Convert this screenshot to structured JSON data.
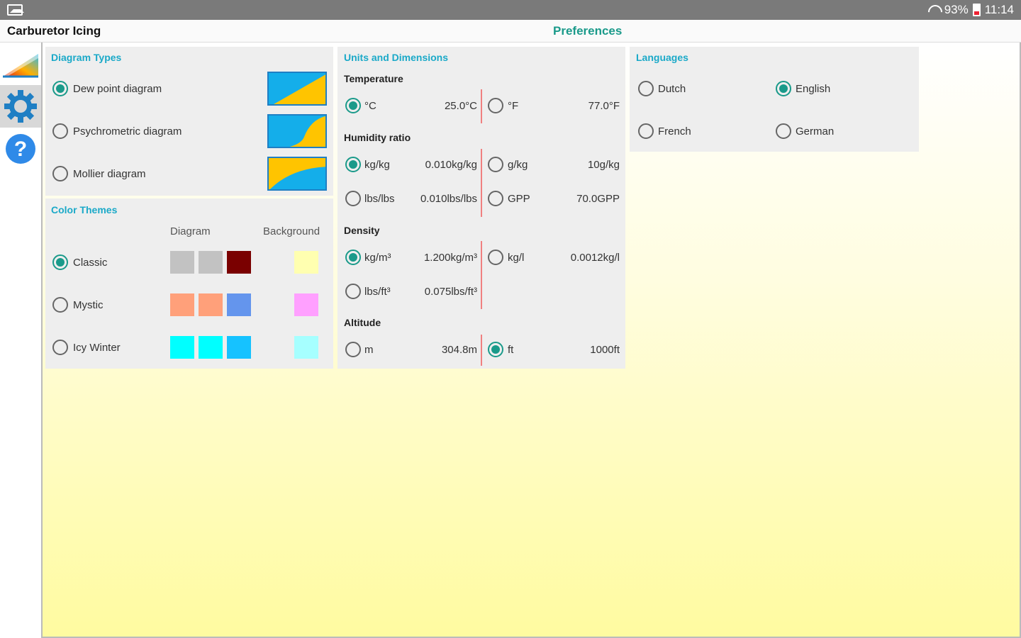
{
  "status": {
    "battery": "93%",
    "time": "11:14"
  },
  "app": {
    "title": "Carburetor Icing",
    "page_title": "Preferences"
  },
  "sidebar": [
    {
      "name": "diagram",
      "active": false
    },
    {
      "name": "settings",
      "active": true
    },
    {
      "name": "help",
      "active": false
    }
  ],
  "diagram_types": {
    "title": "Diagram Types",
    "options": [
      {
        "label": "Dew point diagram",
        "selected": true
      },
      {
        "label": "Psychrometric diagram",
        "selected": false
      },
      {
        "label": "Mollier diagram",
        "selected": false
      }
    ]
  },
  "color_themes": {
    "title": "Color Themes",
    "col_diagram": "Diagram",
    "col_background": "Background",
    "themes": [
      {
        "label": "Classic",
        "selected": true,
        "colors": [
          "#c2c2c2",
          "#c2c2c2",
          "#7a0000"
        ],
        "background": "#ffffb0"
      },
      {
        "label": "Mystic",
        "selected": false,
        "colors": [
          "#ffa07a",
          "#ffa07a",
          "#6495ed"
        ],
        "background": "#ffa0ff"
      },
      {
        "label": "Icy Winter",
        "selected": false,
        "colors": [
          "#00ffff",
          "#00ffff",
          "#16c2ff"
        ],
        "background": "#a6ffff"
      }
    ]
  },
  "units": {
    "title": "Units and Dimensions",
    "temperature": {
      "title": "Temperature",
      "left": {
        "unit": "°C",
        "value": "25.0°C",
        "selected": true
      },
      "right": {
        "unit": "°F",
        "value": "77.0°F",
        "selected": false
      }
    },
    "humidity": {
      "title": "Humidity ratio",
      "rows": [
        {
          "left": {
            "unit": "kg/kg",
            "value": "0.010kg/kg",
            "selected": true
          },
          "right": {
            "unit": "g/kg",
            "value": "10g/kg",
            "selected": false
          }
        },
        {
          "left": {
            "unit": "lbs/lbs",
            "value": "0.010lbs/lbs",
            "selected": false
          },
          "right": {
            "unit": "GPP",
            "value": "70.0GPP",
            "selected": false
          }
        }
      ]
    },
    "density": {
      "title": "Density",
      "rows": [
        {
          "left": {
            "unit": "kg/m³",
            "value": "1.200kg/m³",
            "selected": true
          },
          "right": {
            "unit": "kg/l",
            "value": "0.0012kg/l",
            "selected": false
          }
        },
        {
          "left": {
            "unit": "lbs/ft³",
            "value": "0.075lbs/ft³",
            "selected": false
          }
        }
      ]
    },
    "altitude": {
      "title": "Altitude",
      "left": {
        "unit": "m",
        "value": "304.8m",
        "selected": false
      },
      "right": {
        "unit": "ft",
        "value": "1000ft",
        "selected": true
      }
    }
  },
  "languages": {
    "title": "Languages",
    "options": [
      {
        "label": "Dutch",
        "selected": false
      },
      {
        "label": "English",
        "selected": true
      },
      {
        "label": "French",
        "selected": false
      },
      {
        "label": "German",
        "selected": false
      }
    ]
  },
  "colors": {
    "accent": "#1a9a8a",
    "header_blue": "#1aa9c8",
    "divider": "#f08080",
    "thumb_blue": "#14aeea",
    "thumb_yellow": "#ffc400"
  }
}
